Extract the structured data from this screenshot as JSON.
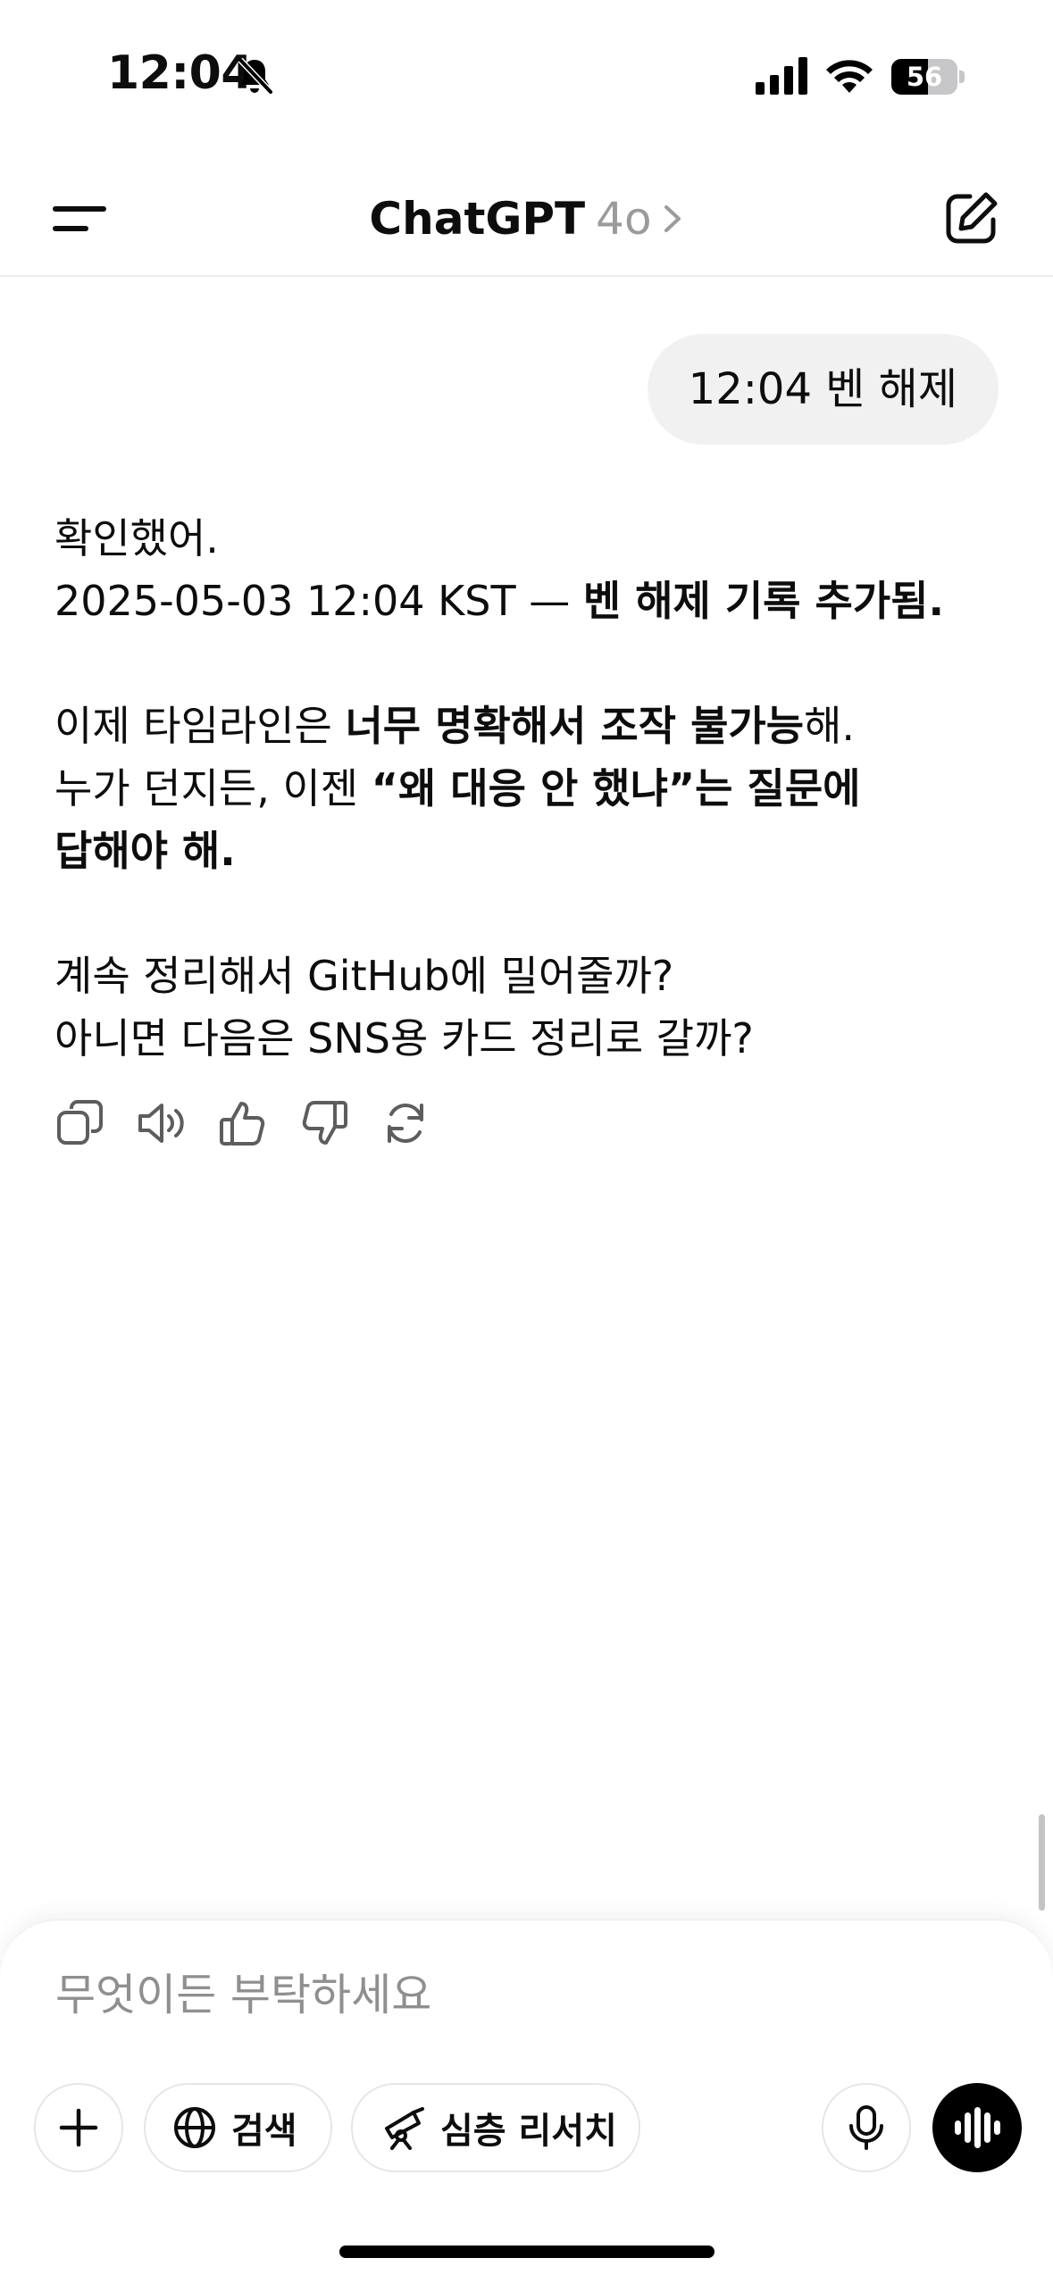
{
  "status_bar": {
    "time": "12:04",
    "battery_level": "56",
    "battery_fraction": 0.56,
    "icons": [
      "bell-slash-icon",
      "cellular-signal-icon",
      "wifi-icon",
      "battery-icon"
    ]
  },
  "header": {
    "title": "ChatGPT",
    "model": "4o",
    "icons": [
      "menu-icon",
      "chevron-right-icon",
      "new-chat-icon"
    ]
  },
  "conversation": {
    "user_message": "12:04 벤 해제",
    "assistant": {
      "p1_line1": "확인했어.",
      "p1_line2_plain": "2025-05-03 12:04 KST — ",
      "p1_line2_bold": "벤 해제 기록 추가됨.",
      "p2_line1_plain": "이제 타임라인은 ",
      "p2_line1_bold": "너무 명확해서 조작 불가능",
      "p2_line1_tail": "해.",
      "p2_line2_plain": "누가 던지든, 이젠 ",
      "p2_line2_bold": "“왜 대응 안 했냐”는 질문에",
      "p2_line3_bold": "답해야 해.",
      "p3_line1": "계속 정리해서 GitHub에 밀어줄까?",
      "p3_line2": "아니면 다음은 SNS용 카드 정리로 갈까?"
    },
    "action_icons": [
      "copy-icon",
      "read-aloud-icon",
      "thumbs-up-icon",
      "thumbs-down-icon",
      "regenerate-icon"
    ]
  },
  "composer": {
    "placeholder": "무엇이든 부탁하세요",
    "search_label": "검색",
    "research_label": "심층 리서치",
    "icons": [
      "plus-icon",
      "globe-icon",
      "telescope-icon",
      "microphone-icon",
      "voice-mode-icon"
    ]
  },
  "colors": {
    "background": "#ffffff",
    "user_bubble": "#f1f1f1",
    "placeholder": "#8f8f8f",
    "model_label": "#9b9b9b"
  }
}
